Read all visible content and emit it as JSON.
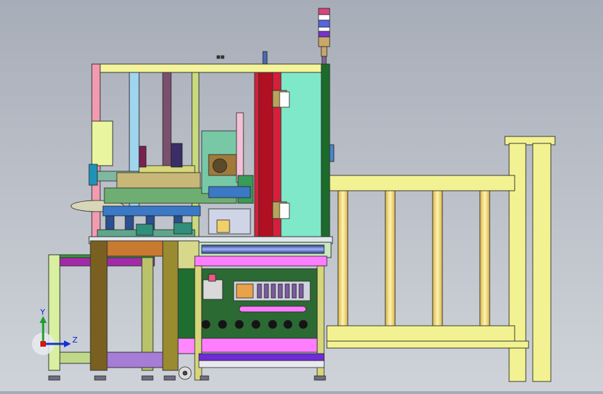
{
  "viewport": {
    "background_top": "#a7adb8",
    "background_bottom": "#cfd3d9"
  },
  "triad": {
    "x_label": "",
    "y_label": "Y",
    "z_label": "Z",
    "y_color": "#1b9e2a",
    "z_color": "#1530d4",
    "x_color": "#d41515"
  },
  "model": {
    "frame_color": "#f4f49a",
    "signal_tower_colors": [
      "#d8457a",
      "#ffffff",
      "#5566dd",
      "#ffffff",
      "#7733cc",
      "#c9a76a"
    ],
    "accent_colors": [
      "#ff77ff",
      "#7ee8c8",
      "#d61f3a",
      "#1b6b2a",
      "#8a6a1c",
      "#9b59d0"
    ]
  }
}
